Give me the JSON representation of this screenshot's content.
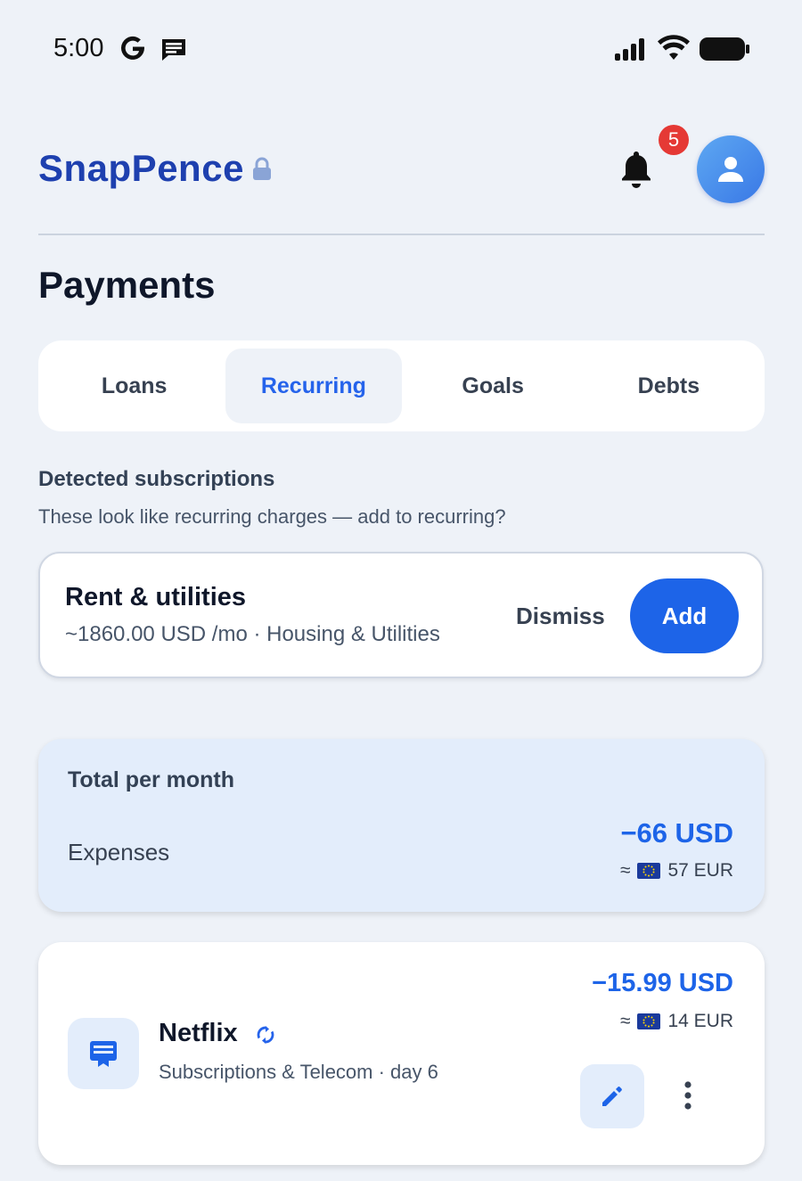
{
  "status_bar": {
    "time": "5:00"
  },
  "header": {
    "app_title": "SnapPence",
    "notification_count": "5"
  },
  "page": {
    "title": "Payments"
  },
  "tabs": [
    {
      "label": "Loans",
      "active": false
    },
    {
      "label": "Recurring",
      "active": true
    },
    {
      "label": "Goals",
      "active": false
    },
    {
      "label": "Debts",
      "active": false
    }
  ],
  "detected": {
    "heading": "Detected subscriptions",
    "subtitle": "These look like recurring charges — add to recurring?",
    "item": {
      "name": "Rent & utilities",
      "meta": "~1860.00 USD /mo · Housing & Utilities",
      "dismiss_label": "Dismiss",
      "add_label": "Add"
    }
  },
  "total": {
    "title": "Total per month",
    "label": "Expenses",
    "amount": "−66 USD",
    "converted": "≈",
    "converted_value": "57 EUR"
  },
  "items": [
    {
      "name": "Netflix",
      "meta": "Subscriptions & Telecom · day 6",
      "amount": "−15.99 USD",
      "converted": "≈",
      "converted_value": "14 EUR",
      "icon": "subscription-card-icon"
    }
  ],
  "colors": {
    "accent": "#1d64e8",
    "brand": "#1e40af",
    "badge": "#e53935",
    "background": "#eef2f8"
  }
}
